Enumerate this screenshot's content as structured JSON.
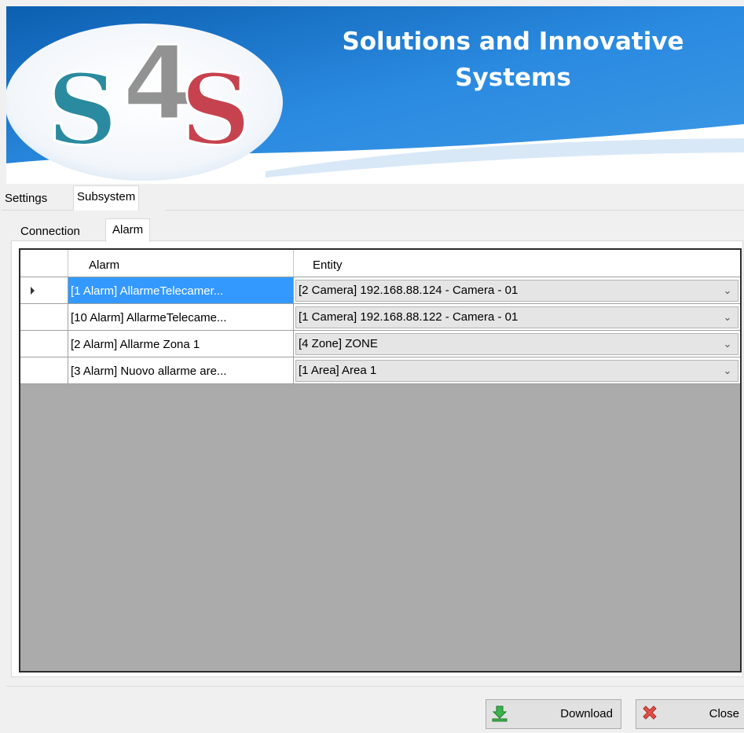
{
  "banner": {
    "logo_text": "S4S",
    "title_line1": "Solutions and Innovative",
    "title_line2": "Systems"
  },
  "main_tabs": [
    {
      "label": "Settings",
      "active": false
    },
    {
      "label": "Subsystem",
      "active": true
    }
  ],
  "sub_tabs": [
    {
      "label": "Connection",
      "active": false
    },
    {
      "label": "Alarm",
      "active": true
    }
  ],
  "grid": {
    "columns": [
      "Alarm",
      "Entity"
    ],
    "rows": [
      {
        "alarm": "[1 Alarm] AllarmeTelecamer...",
        "entity": "[2 Camera] 192.168.88.124 - Camera - 01",
        "current": true,
        "selected": true
      },
      {
        "alarm": "[10 Alarm] AllarmeTelecame...",
        "entity": "[1 Camera] 192.168.88.122 - Camera - 01",
        "current": false,
        "selected": false
      },
      {
        "alarm": "[2 Alarm] Allarme Zona 1",
        "entity": "[4 Zone] ZONE",
        "current": false,
        "selected": false
      },
      {
        "alarm": "[3 Alarm] Nuovo allarme are...",
        "entity": "[1 Area] Area 1",
        "current": false,
        "selected": false
      }
    ]
  },
  "buttons": {
    "download": {
      "label": "Download",
      "icon": "download-arrow-icon"
    },
    "close": {
      "label": "Close",
      "icon": "close-x-icon"
    }
  },
  "colors": {
    "banner_blue": "#1a78c8",
    "selection": "#3399ff",
    "grid_background": "#ababab"
  }
}
